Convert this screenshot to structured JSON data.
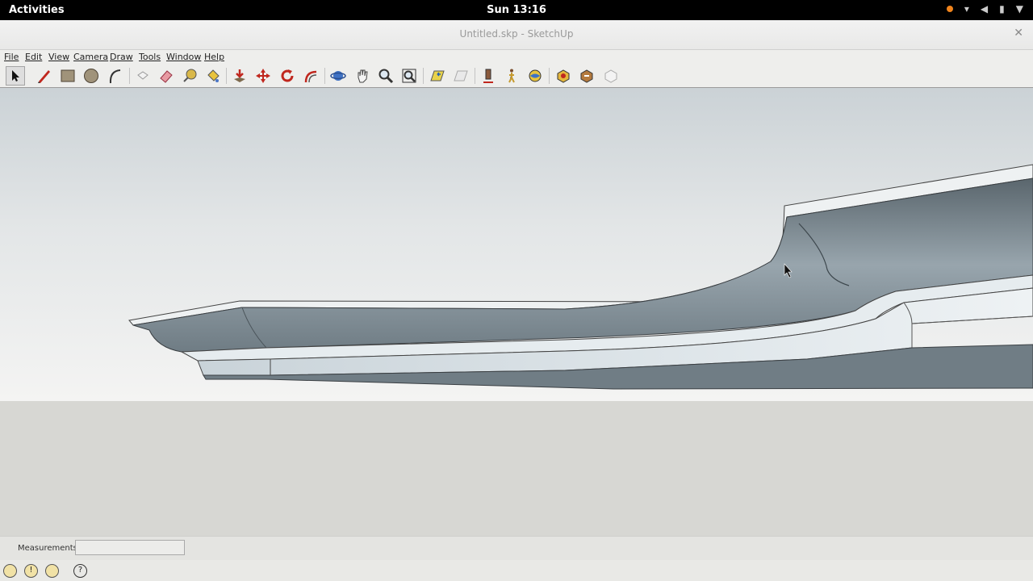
{
  "system_bar": {
    "activities": "Activities",
    "clock": "Sun 13:16",
    "tray_icons": [
      "notification-dot-icon",
      "wifi-icon",
      "volume-icon",
      "battery-icon",
      "dropdown-arrow-icon"
    ]
  },
  "window": {
    "title": "Untitled.skp - SketchUp"
  },
  "menu": {
    "items": [
      "File",
      "Edit",
      "View",
      "Camera",
      "Draw",
      "Tools",
      "Window",
      "Help"
    ]
  },
  "toolbar": {
    "tools": [
      "select-icon",
      "pencil-icon",
      "rectangle-icon",
      "circle-icon",
      "arc-icon",
      "make-component-icon",
      "eraser-icon",
      "tape-measure-icon",
      "paint-bucket-icon",
      "push-pull-icon",
      "move-icon",
      "rotate-icon",
      "offset-icon",
      "orbit-icon",
      "pan-icon",
      "zoom-icon",
      "zoom-extents-icon",
      "previous-view-icon",
      "next-view-icon",
      "position-camera-icon",
      "walk-icon",
      "look-around-icon",
      "get-models-icon",
      "share-model-icon",
      "extension-warehouse-icon"
    ]
  },
  "status": {
    "measurements_label": "Measurements",
    "measurements_value": ""
  },
  "bottom_icons": [
    "geo-location-icon",
    "credits-icon",
    "user-icon",
    "help-icon"
  ],
  "colors": {
    "sky_top": "#cbd2d6",
    "ground": "#d7d7d3",
    "molding_shadow": "#6f7d86",
    "molding_light": "#e8edf0"
  }
}
